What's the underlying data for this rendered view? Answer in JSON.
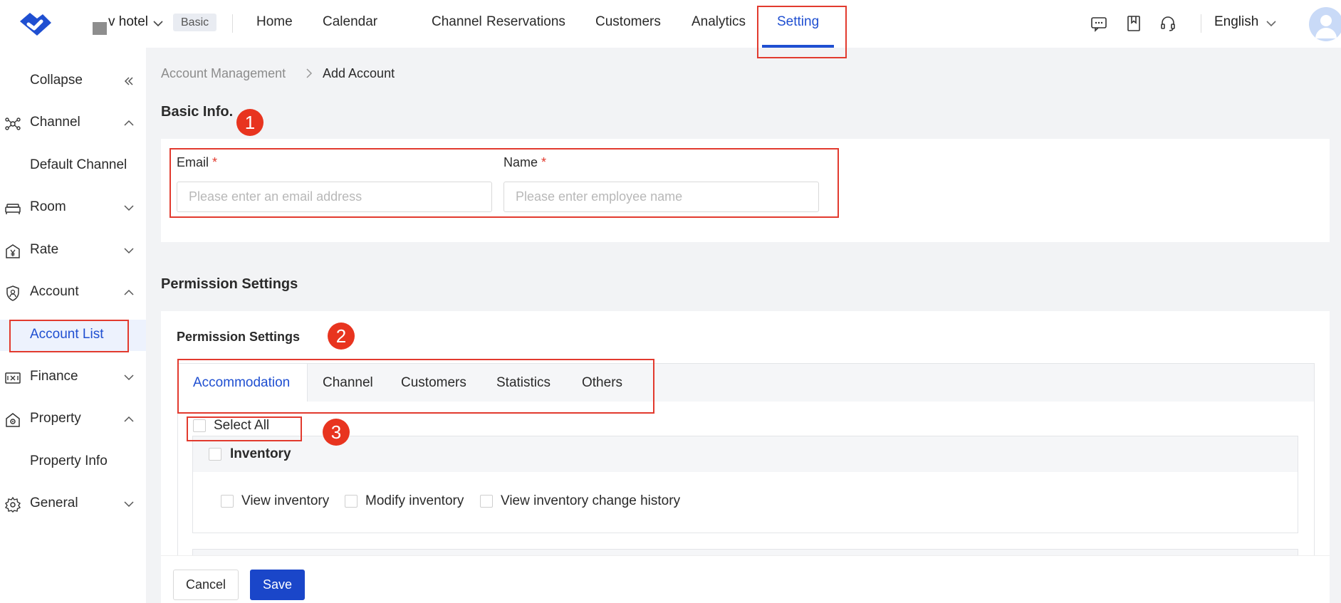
{
  "topbar": {
    "hotel_name": "v hotel",
    "plan_badge": "Basic",
    "nav": [
      "Home",
      "Calendar",
      "Channel",
      "Reservations",
      "Customers",
      "Analytics",
      "Setting"
    ],
    "active_nav": "Setting",
    "language": "English",
    "icons": [
      "message-icon",
      "bookmark-icon",
      "headset-icon"
    ]
  },
  "sidebar": {
    "collapse": "Collapse",
    "items": [
      {
        "label": "Channel",
        "icon": "channel-icon",
        "expanded": true
      },
      {
        "label": "Default Channel"
      },
      {
        "label": "Room",
        "icon": "bed-icon",
        "expanded": false
      },
      {
        "label": "Rate",
        "icon": "yen-icon",
        "expanded": false
      },
      {
        "label": "Account",
        "icon": "shield-user-icon",
        "expanded": true
      },
      {
        "label": "Account List",
        "active": true
      },
      {
        "label": "Finance",
        "icon": "finance-icon",
        "expanded": false
      },
      {
        "label": "Property",
        "icon": "property-icon",
        "expanded": true
      },
      {
        "label": "Property Info"
      },
      {
        "label": "General",
        "icon": "gear-icon",
        "expanded": false
      }
    ]
  },
  "breadcrumb": {
    "root": "Account Management",
    "current": "Add Account"
  },
  "basic_info": {
    "title": "Basic Info.",
    "email_label": "Email",
    "email_placeholder": "Please enter an email address",
    "name_label": "Name",
    "name_placeholder": "Please enter employee name",
    "required_mark": "*"
  },
  "permission": {
    "title": "Permission Settings",
    "subtitle": "Permission Settings",
    "tabs": [
      "Accommodation",
      "Channel",
      "Customers",
      "Statistics",
      "Others"
    ],
    "active_tab": "Accommodation",
    "select_all": "Select All",
    "groups": [
      {
        "name": "Inventory",
        "options": [
          "View inventory",
          "Modify inventory",
          "View inventory change history"
        ]
      }
    ]
  },
  "footer": {
    "cancel": "Cancel",
    "save": "Save"
  },
  "annotations": [
    "1",
    "2",
    "3"
  ],
  "colors": {
    "accent": "#1f4fd1",
    "annotation": "#e23a2e",
    "save_button": "#1a46c9"
  }
}
